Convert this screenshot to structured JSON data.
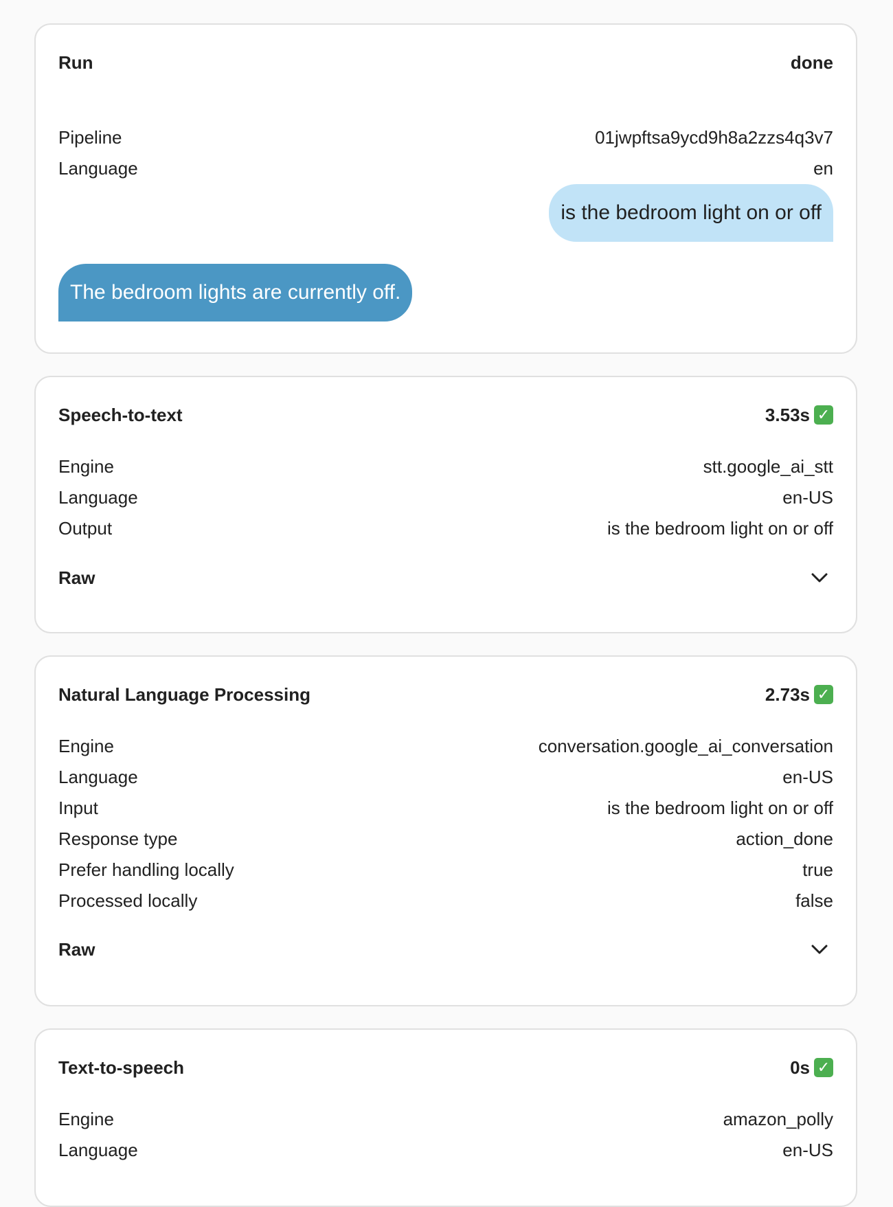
{
  "run": {
    "title": "Run",
    "status": "done",
    "rows": [
      {
        "label": "Pipeline",
        "value": "01jwpftsa9ycd9h8a2zzs4q3v7"
      },
      {
        "label": "Language",
        "value": "en"
      }
    ],
    "user_message": "is the bedroom light on or off",
    "assistant_message": "The bedroom lights are currently off."
  },
  "stt": {
    "title": "Speech-to-text",
    "duration": "3.53s",
    "status_icon": "check-icon",
    "rows": [
      {
        "label": "Engine",
        "value": "stt.google_ai_stt"
      },
      {
        "label": "Language",
        "value": "en-US"
      },
      {
        "label": "Output",
        "value": "is the bedroom light on or off"
      }
    ],
    "raw_label": "Raw"
  },
  "nlp": {
    "title": "Natural Language Processing",
    "duration": "2.73s",
    "status_icon": "check-icon",
    "rows": [
      {
        "label": "Engine",
        "value": "conversation.google_ai_conversation"
      },
      {
        "label": "Language",
        "value": "en-US"
      },
      {
        "label": "Input",
        "value": "is the bedroom light on or off"
      },
      {
        "label": "Response type",
        "value": "action_done"
      },
      {
        "label": "Prefer handling locally",
        "value": "true"
      },
      {
        "label": "Processed locally",
        "value": "false"
      }
    ],
    "raw_label": "Raw"
  },
  "tts": {
    "title": "Text-to-speech",
    "duration": "0s",
    "status_icon": "check-icon",
    "rows": [
      {
        "label": "Engine",
        "value": "amazon_polly"
      },
      {
        "label": "Language",
        "value": "en-US"
      }
    ]
  },
  "colors": {
    "user_bubble": "#c1e3f7",
    "assistant_bubble": "#4b97c4",
    "check_green": "#4caf50"
  }
}
